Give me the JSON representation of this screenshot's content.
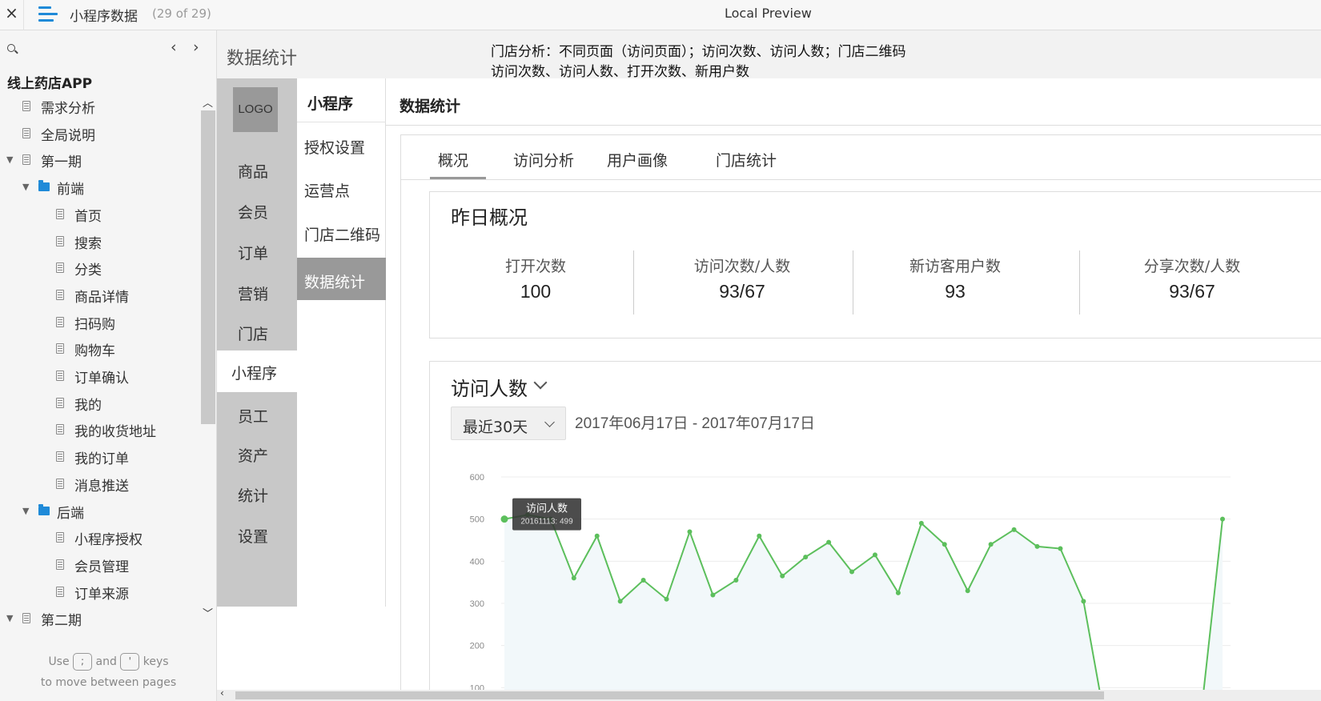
{
  "topbar": {
    "close": "×",
    "doc_title": "小程序数据",
    "doc_count": "(29 of 29)",
    "preview": "Local Preview"
  },
  "sidebar": {
    "prev": "‹",
    "next": "›",
    "project": "线上药店APP",
    "items": [
      {
        "label": "需求分析",
        "type": "page",
        "level": 0,
        "caret": ""
      },
      {
        "label": "全局说明",
        "type": "page",
        "level": 0,
        "caret": ""
      },
      {
        "label": "第一期",
        "type": "page",
        "level": 0,
        "caret": "▼"
      },
      {
        "label": "前端",
        "type": "folder",
        "level": 1,
        "caret": "▼"
      },
      {
        "label": "首页",
        "type": "page",
        "level": 2,
        "caret": ""
      },
      {
        "label": "搜索",
        "type": "page",
        "level": 2,
        "caret": ""
      },
      {
        "label": "分类",
        "type": "page",
        "level": 2,
        "caret": ""
      },
      {
        "label": "商品详情",
        "type": "page",
        "level": 2,
        "caret": ""
      },
      {
        "label": "扫码购",
        "type": "page",
        "level": 2,
        "caret": ""
      },
      {
        "label": "购物车",
        "type": "page",
        "level": 2,
        "caret": ""
      },
      {
        "label": "订单确认",
        "type": "page",
        "level": 2,
        "caret": ""
      },
      {
        "label": "我的",
        "type": "page",
        "level": 2,
        "caret": ""
      },
      {
        "label": "我的收货地址",
        "type": "page",
        "level": 2,
        "caret": ""
      },
      {
        "label": "我的订单",
        "type": "page",
        "level": 2,
        "caret": ""
      },
      {
        "label": "消息推送",
        "type": "page",
        "level": 2,
        "caret": ""
      },
      {
        "label": "后端",
        "type": "folder",
        "level": 1,
        "caret": "▼"
      },
      {
        "label": "小程序授权",
        "type": "page",
        "level": 2,
        "caret": ""
      },
      {
        "label": "会员管理",
        "type": "page",
        "level": 2,
        "caret": ""
      },
      {
        "label": "订单来源",
        "type": "page",
        "level": 2,
        "caret": ""
      },
      {
        "label": "第二期",
        "type": "page",
        "level": 0,
        "caret": "▼"
      }
    ],
    "hint": {
      "use": "Use",
      "and": "and",
      "keys": "keys",
      "line2": "to move between pages",
      "key_prev": ";",
      "key_next": "'"
    }
  },
  "content": {
    "heading": "数据统计",
    "notes": [
      "门店分析：不同页面（访问页面）；访问次数、访问人数；门店二维码",
      "访问次数、访问人数、打开次数、新用户数"
    ],
    "logo": "LOGO",
    "main_nav": [
      "商品",
      "会员",
      "订单",
      "营销",
      "门店",
      "小程序",
      "员工",
      "资产",
      "统计",
      "设置"
    ],
    "main_nav_active": "小程序",
    "sub_nav_title": "小程序",
    "sub_nav": [
      "授权设置",
      "运营点",
      "门店二维码",
      "数据统计"
    ],
    "sub_nav_active": "数据统计",
    "panel_title": "数据统计",
    "tabs": [
      "概况",
      "访问分析",
      "用户画像",
      "门店统计"
    ],
    "active_tab": "概况",
    "summary": {
      "title": "昨日概况",
      "stats": [
        {
          "label": "打开次数",
          "value": "100"
        },
        {
          "label": "访问次数/人数",
          "value": "93/67"
        },
        {
          "label": "新访客用户数",
          "value": "93"
        },
        {
          "label": "分享次数/人数",
          "value": "93/67"
        }
      ]
    },
    "chart_card": {
      "title": "访问人数",
      "range": "最近30天",
      "dates": "2017年06月17日 - 2017年07月17日"
    }
  },
  "chart_data": {
    "type": "area",
    "title": "",
    "xlabel": "",
    "ylabel": "",
    "ylim": [
      0,
      600
    ],
    "yticks": [
      "600",
      "500",
      "400",
      "300",
      "200",
      "100"
    ],
    "grid": true,
    "color": "#5cbf5c",
    "fill": "#f2f8fa",
    "series": [
      {
        "name": "访问人数",
        "values": [
          500,
          510,
          500,
          360,
          460,
          305,
          355,
          310,
          470,
          320,
          355,
          460,
          365,
          410,
          445,
          375,
          415,
          325,
          490,
          440,
          330,
          440,
          475,
          435,
          430,
          305,
          0,
          0,
          0,
          0,
          0,
          500
        ]
      }
    ],
    "tooltip": {
      "title": "访问人数",
      "text": "20161113: 499"
    }
  }
}
